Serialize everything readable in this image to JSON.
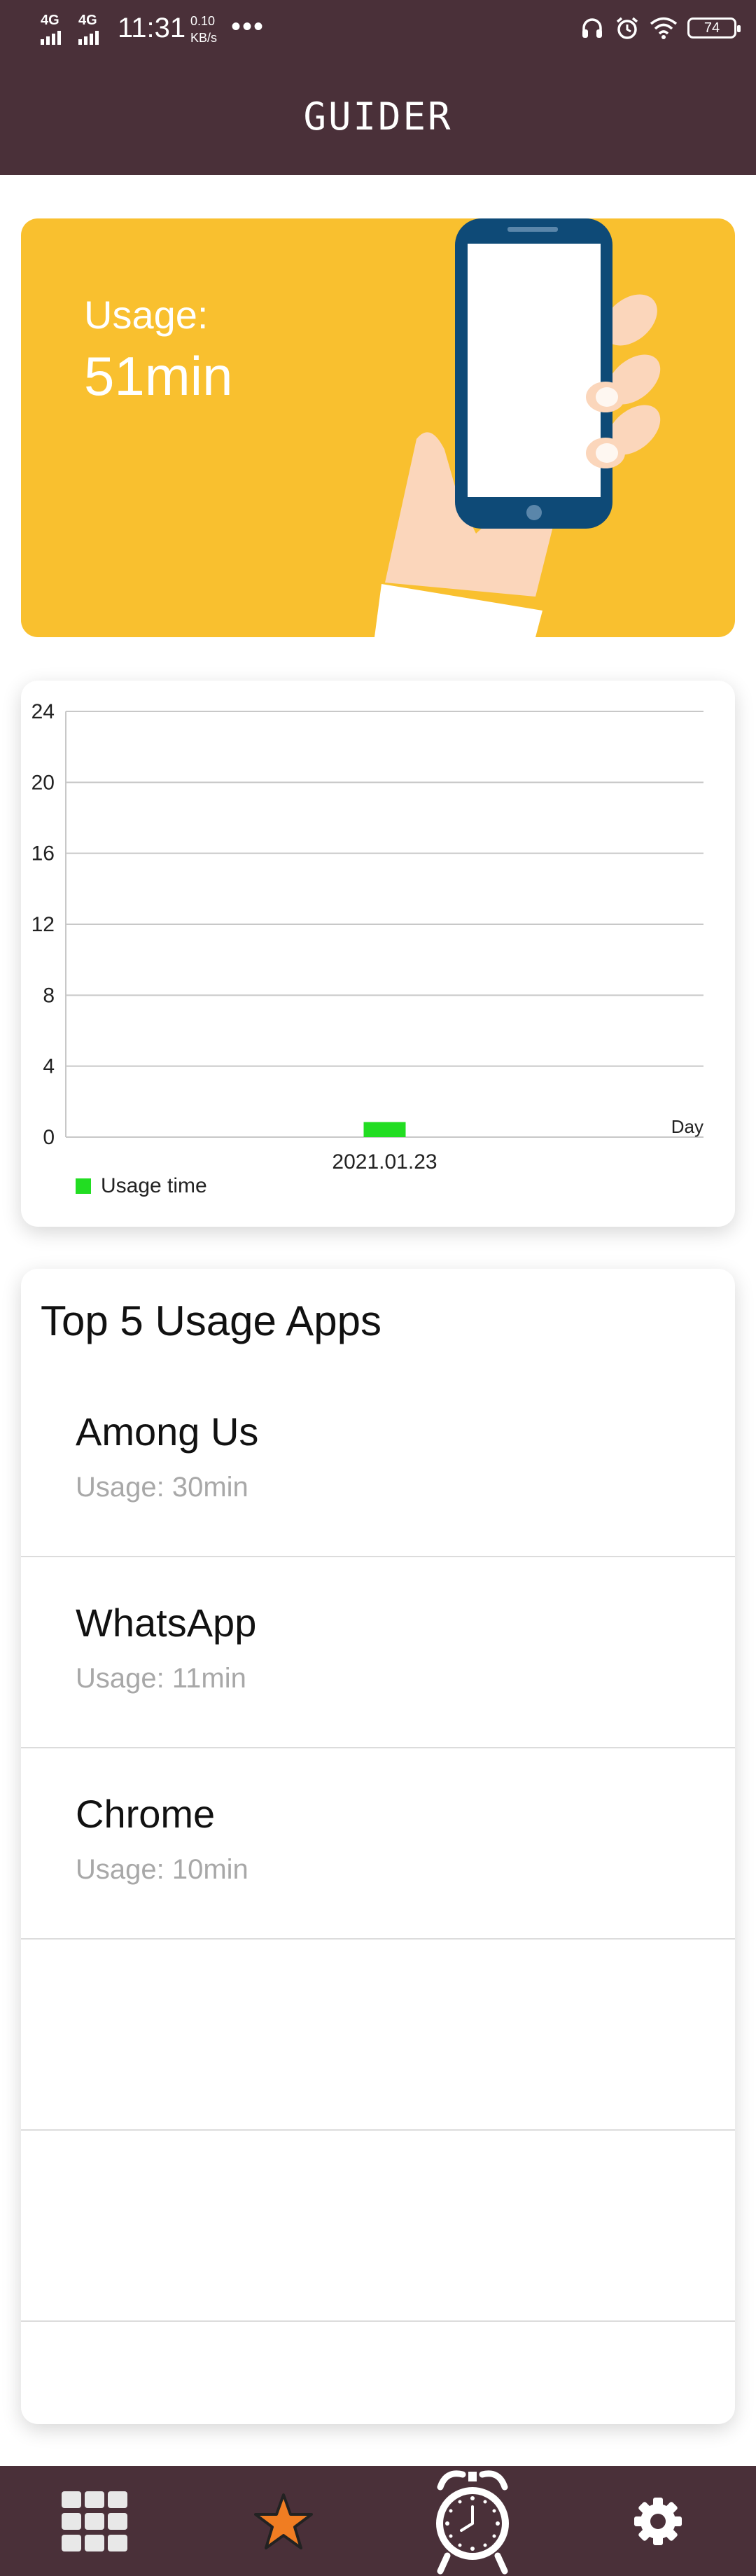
{
  "status_bar": {
    "signal_1": "4G",
    "signal_2": "4G",
    "time": "11:31",
    "speed_value": "0.10",
    "speed_unit": "KB/s",
    "more": "•••",
    "battery": "74"
  },
  "header": {
    "title": "GUIDER"
  },
  "hero": {
    "label": "Usage:",
    "value": "51min"
  },
  "chart_data": {
    "type": "bar",
    "categories": [
      "2021.01.23"
    ],
    "series": [
      {
        "name": "Usage time",
        "values": [
          0.85
        ],
        "color": "#22dd22"
      }
    ],
    "y_ticks": [
      "0",
      "4",
      "8",
      "12",
      "16",
      "20",
      "24"
    ],
    "ylim": [
      0,
      24
    ],
    "xlabel": "Day",
    "ylabel": "",
    "grid": true,
    "legend_position": "bottom-left"
  },
  "top_apps": {
    "title": "Top 5 Usage Apps",
    "items": [
      {
        "name": "Among Us",
        "usage": "Usage: 30min"
      },
      {
        "name": "WhatsApp",
        "usage": "Usage: 11min"
      },
      {
        "name": "Chrome",
        "usage": "Usage: 10min"
      },
      {
        "name": "",
        "usage": ""
      },
      {
        "name": "",
        "usage": ""
      }
    ]
  },
  "bottom_nav": {
    "items": [
      {
        "icon": "grid-icon"
      },
      {
        "icon": "star-icon"
      },
      {
        "icon": "alarm-clock-icon"
      },
      {
        "icon": "gear-icon"
      }
    ]
  },
  "colors": {
    "header_bg": "#4a3039",
    "hero_bg": "#f9c02f",
    "series": "#22dd22",
    "star": "#f07d22"
  }
}
